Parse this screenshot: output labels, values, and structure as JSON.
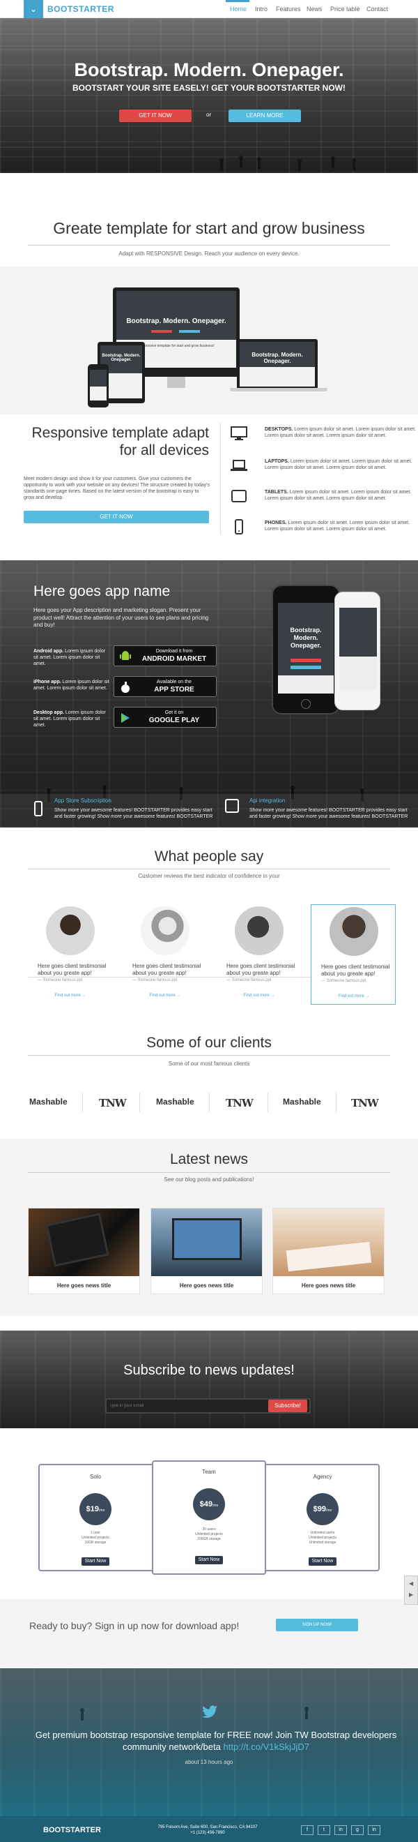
{
  "nav": {
    "brand": "BOOTSTARTER",
    "items": [
      "Home",
      "Intro",
      "Features",
      "News",
      "Price table",
      "Contact"
    ]
  },
  "hero": {
    "title": "Bootstrap. Modern. Onepager.",
    "subtitle": "BOOTSTART YOUR SITE EASELY! GET YOUR BOOTSTARTER NOW!",
    "btn_primary": "GET IT NOW",
    "or": "or",
    "btn_secondary": "LEARN MORE"
  },
  "template": {
    "title": "Greate template for start and grow business",
    "subtitle": "Adapt with RESPONSIVE Design. Reach your audience on every device.",
    "screen_title": "Bootstrap. Modern. Onepager.",
    "screen_sub": "Responsive template for start and grow business!",
    "resp_title": "Responsive template adapt for all devices",
    "resp_text": "Meet modern design and show it for your customers. Give your customers the opportunity to work with your website on any devices! The structure created by today's standards one-page times. Based on the latest version of the bootstrap is easy to grow and develop.",
    "resp_btn": "GET IT NOW",
    "features": [
      {
        "name": "DESKTOPS.",
        "text": "Lorem ipsum dolor sit amet. Lorem ipsum dolor sit amet. Lorem ipsum dolor sit amet. Lorem ipsum dolor sit amet."
      },
      {
        "name": "LAPTOPS.",
        "text": "Lorem ipsum dolor sit amet. Lorem ipsum dolor sit amet. Lorem ipsum dolor sit amet. Lorem ipsum dolor sit amet."
      },
      {
        "name": "TABLETS.",
        "text": "Lorem ipsum dolor sit amet. Lorem ipsum dolor sit amet. Lorem ipsum dolor sit amet. Lorem ipsum dolor sit amet."
      },
      {
        "name": "PHONES.",
        "text": "Lorem ipsum dolor sit amet. Lorem ipsum dolor sit amet. Lorem ipsum dolor sit amet. Lorem ipsum dolor sit amet."
      }
    ]
  },
  "app": {
    "title": "Here goes app name",
    "desc": "Here goes your App description and marketing slogan. Present your product well! Attract the attention of your users to see plans and pricing and buy!",
    "phone_title": "Bootstrap. Modern. Onepager.",
    "stores": [
      {
        "platform": "Android app.",
        "text": "Lorem ipsum dolor sit amet. Lorem ipsum dolor sit amet.",
        "line1": "Download it from",
        "line2": "ANDROID MARKET"
      },
      {
        "platform": "iPhone app.",
        "text": "Lorem ipsum dolor sit amet. Lorem ipsum dolor sit amet.",
        "line1": "Available on the",
        "line2": "APP STORE"
      },
      {
        "platform": "Desktop app.",
        "text": "Lorem ipsum dolor sit amet. Lorem ipsum dolor sit amet.",
        "line1": "Get it on",
        "line2": "GOOGLE PLAY"
      }
    ],
    "feature1_title": "App Store Subscription",
    "feature1_text": "Show more your awesome features! BOOTSTARTER provides easy start and faster growing! Show more your awesome features! BOOTSTARTER",
    "feature2_title": "Api integration",
    "feature2_text": "Show more your awesome features! BOOTSTARTER provides easy start and faster growing! Show more your awesome features! BOOTSTARTER"
  },
  "testimonials": {
    "title": "What people say",
    "subtitle": "Customer reviews the best indicator of confidence in your",
    "items": [
      {
        "quote": "Here goes client testimonial about you greate app!",
        "author": "— Someone famous.ppl",
        "more": "Find out more →"
      },
      {
        "quote": "Here goes client testimonial about you greate app!",
        "author": "— Someone famous.ppl",
        "more": "Find out more →"
      },
      {
        "quote": "Here goes client testimonial about you greate app!",
        "author": "— Someone famous.ppl",
        "more": "Find out more →"
      },
      {
        "quote": "Here goes client testimonial about you greate app!",
        "author": "— Someone famous.ppl",
        "more": "Find out more →"
      }
    ]
  },
  "clients": {
    "title": "Some of our clients",
    "subtitle": "Some of our most famous clients",
    "logos": [
      "Mashable",
      "TNW",
      "Mashable",
      "TNW",
      "Mashable",
      "TNW"
    ]
  },
  "news": {
    "title": "Latest news",
    "subtitle": "See our blog posts and publications!",
    "items": [
      "Here goes news title",
      "Here goes news title",
      "Here goes news title"
    ]
  },
  "subscribe": {
    "title": "Subscribe to news updates!",
    "placeholder": "Type in your Email",
    "button": "Subscribe!"
  },
  "pricing": {
    "plans": [
      {
        "name": "Solo",
        "price": "$19",
        "per": "/mo",
        "features": [
          "1 user",
          "Unlimited projects",
          "10GB storage"
        ],
        "button": "Start Now"
      },
      {
        "name": "Team",
        "price": "$49",
        "per": "/mo",
        "features": [
          "30 users",
          "Unlimited projects",
          "200GB storage"
        ],
        "button": "Start Now"
      },
      {
        "name": "Agency",
        "price": "$99",
        "per": "/mo",
        "features": [
          "Unlimited users",
          "Unlimited projects",
          "Unlimited storage"
        ],
        "button": "Start Now"
      }
    ]
  },
  "ready": {
    "text": "Ready to buy? Sign in up now for download app!",
    "button": "SIGN UP NOW!"
  },
  "twitter": {
    "text": "Get premium bootstrap responsive template for FREE now! Join TW Bootstrap developers community network/beta",
    "link": "http://t.co/V1kSkjJjD7",
    "time": "about 13 hours ago"
  },
  "footer": {
    "brand": "BOOTSTARTER",
    "address": "795 Folsom Ave, Suite 600, San Francisco, CA 94107",
    "phone": "+1 (123) 456-7890",
    "social": [
      "f",
      "t",
      "in",
      "g",
      "in"
    ]
  },
  "colors": {
    "accent": "#44a4cd",
    "button_blue": "#55bce0",
    "button_red": "#e04848",
    "dark": "#2f3a4b"
  }
}
